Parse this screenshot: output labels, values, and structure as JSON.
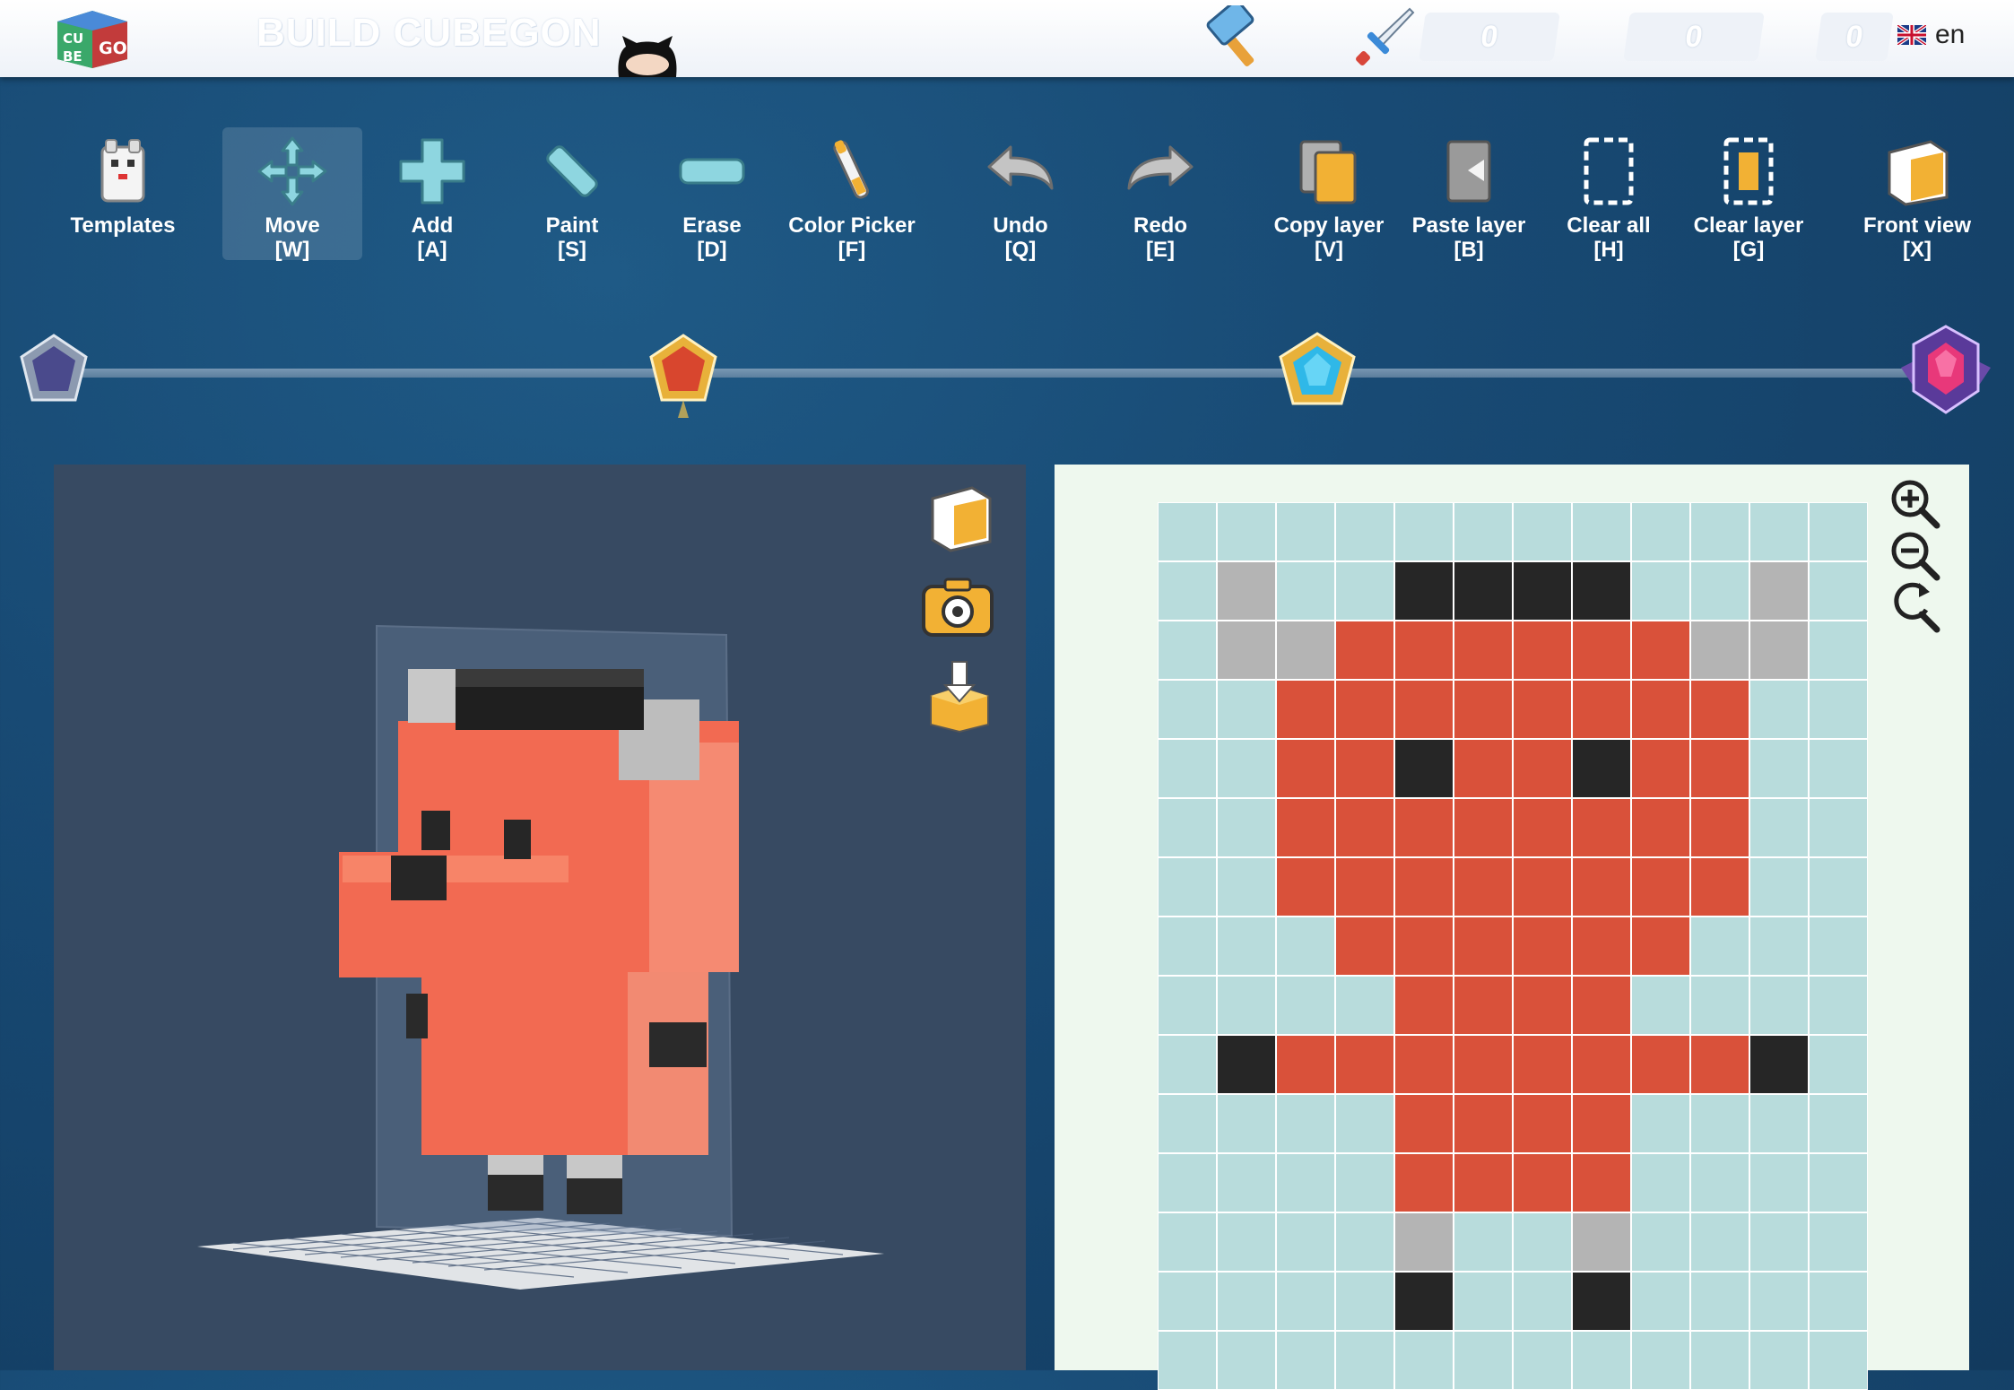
{
  "header": {
    "title": "BUILD CUBEGON",
    "counter_build": "0",
    "counter_battle": "0",
    "counter_third": "0",
    "language": "en",
    "logo_letters": [
      "CU",
      "BE",
      "GO"
    ]
  },
  "toolbar": {
    "tools": [
      {
        "label": "Templates",
        "key": "",
        "icon": "templates-icon",
        "active": false
      },
      {
        "label": "Move",
        "key": "[W]",
        "icon": "move-icon",
        "active": true
      },
      {
        "label": "Add",
        "key": "[A]",
        "icon": "add-icon",
        "active": false
      },
      {
        "label": "Paint",
        "key": "[S]",
        "icon": "paint-icon",
        "active": false
      },
      {
        "label": "Erase",
        "key": "[D]",
        "icon": "erase-icon",
        "active": false
      },
      {
        "label": "Color Picker",
        "key": "[F]",
        "icon": "color-picker-icon",
        "active": false
      },
      {
        "label": "Undo",
        "key": "[Q]",
        "icon": "undo-icon",
        "active": false
      },
      {
        "label": "Redo",
        "key": "[E]",
        "icon": "redo-icon",
        "active": false
      },
      {
        "label": "Copy layer",
        "key": "[V]",
        "icon": "copy-layer-icon",
        "active": false
      },
      {
        "label": "Paste layer",
        "key": "[B]",
        "icon": "paste-layer-icon",
        "active": false
      },
      {
        "label": "Clear all",
        "key": "[H]",
        "icon": "clear-all-icon",
        "active": false
      },
      {
        "label": "Clear layer",
        "key": "[G]",
        "icon": "clear-layer-icon",
        "active": false
      },
      {
        "label": "Front view",
        "key": "[X]",
        "icon": "front-view-icon",
        "active": false
      }
    ]
  },
  "progress": {
    "tiers": [
      "common-gem-icon",
      "rare-gem-icon",
      "epic-gem-icon",
      "legendary-gem-icon"
    ]
  },
  "colors": {
    "red": "#d9513a",
    "black": "#262626",
    "gray": "#b4b4b4",
    "empty": "#b8dcdc",
    "accent": "#f2b134"
  },
  "editor": {
    "legend": {
      ".": "empty",
      "R": "red",
      "K": "black",
      "G": "gray"
    },
    "grid": [
      "............",
      ".G..KKKK..G.",
      ".GGRRRRRRGG.",
      "..RRRRRRRR..",
      "..RRKRRKRR..",
      "..RRRRRRRR..",
      "..RRRRRRRR..",
      "...RRRRRR...",
      "....RRRR....",
      ".KRRRRRRRRK.",
      "....RRRR....",
      "....RRRR....",
      "....G..G....",
      "....K..K....",
      "............"
    ]
  }
}
